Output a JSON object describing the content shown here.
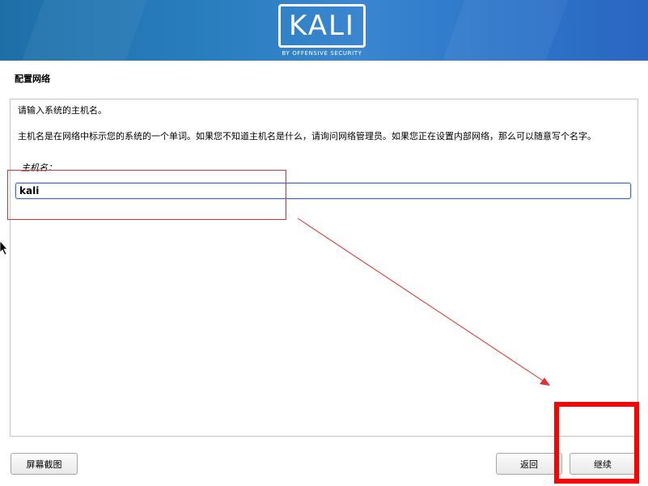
{
  "banner": {
    "logo_text": "KALI",
    "logo_subtitle": "BY OFFENSIVE SECURITY"
  },
  "section": {
    "title": "配置网络"
  },
  "content": {
    "prompt": "请输入系统的主机名。",
    "description": "主机名是在网络中标示您的系统的一个单词。如果您不知道主机名是什么，请询问网络管理员。如果您正在设置内部网络，那么可以随意写个名字。",
    "field_label": "主机名：",
    "hostname_value": "kali"
  },
  "buttons": {
    "screenshot": "屏幕截图",
    "back": "返回",
    "continue": "继续"
  },
  "colors": {
    "banner_accent": "#2a7fc0",
    "annotation_red": "#ff0000",
    "input_focus": "#3a6fc4"
  }
}
